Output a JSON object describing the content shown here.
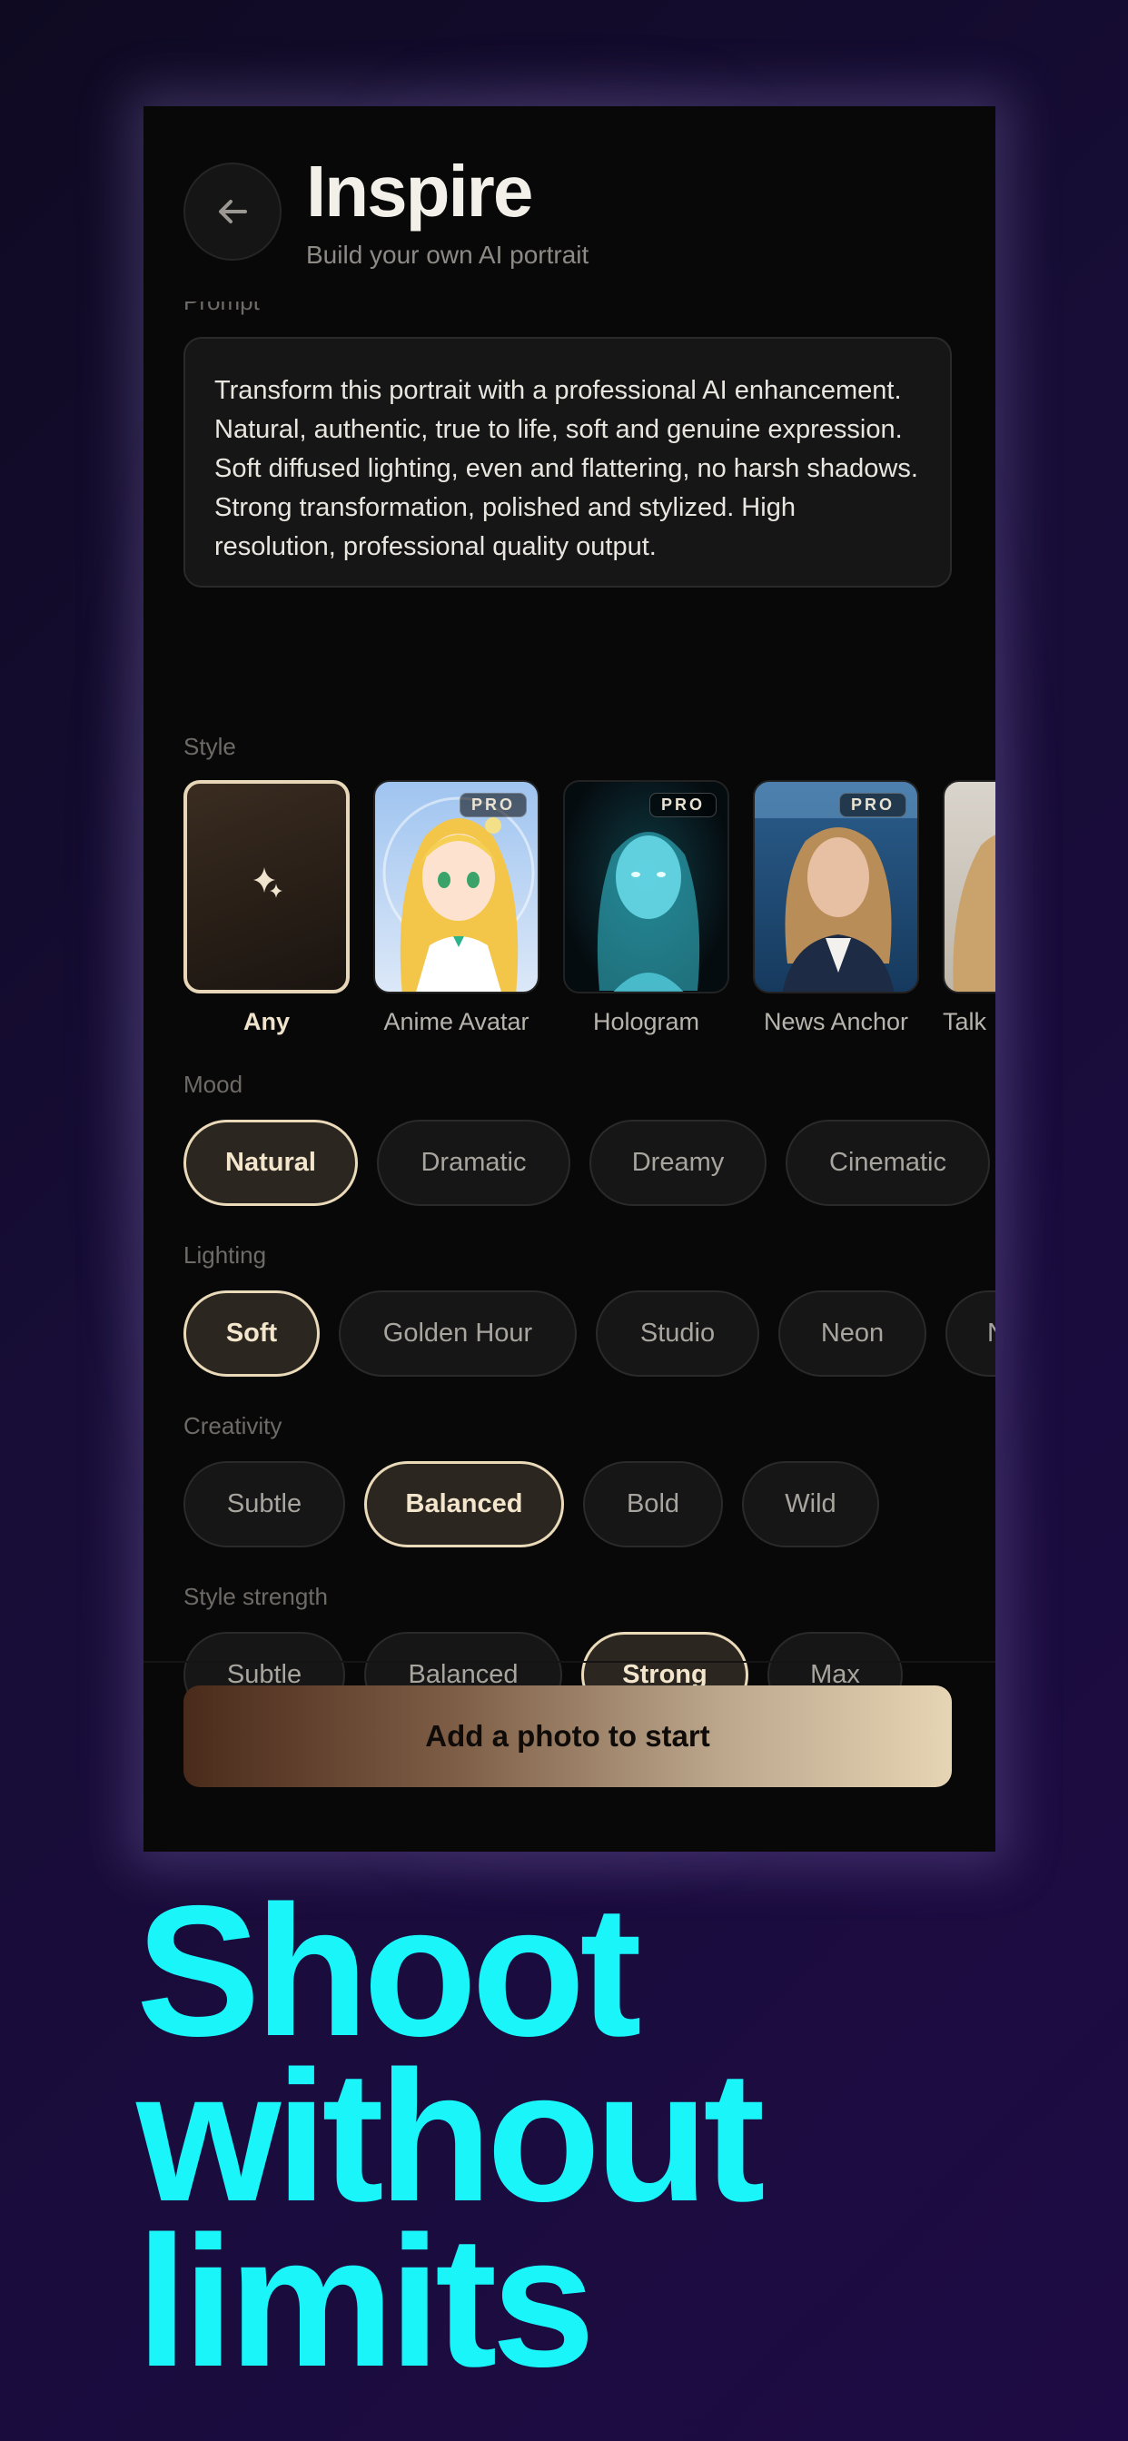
{
  "header": {
    "title": "Inspire",
    "subtitle": "Build your own AI portrait"
  },
  "prompt": {
    "label": "Prompt",
    "text": "Transform this portrait with a professional AI enhancement. Natural, authentic, true to life, soft and genuine expression. Soft diffused lighting, even and flattering, no harsh shadows. Strong transformation, polished and stylized. High resolution, professional quality output."
  },
  "style": {
    "label": "Style",
    "items": [
      {
        "name": "Any",
        "selected": true
      },
      {
        "name": "Anime Avatar",
        "badge": "PRO"
      },
      {
        "name": "Hologram",
        "badge": "PRO"
      },
      {
        "name": "News Anchor",
        "badge": "PRO"
      },
      {
        "name": "Talk"
      }
    ]
  },
  "mood": {
    "label": "Mood",
    "options": [
      "Natural",
      "Dramatic",
      "Dreamy",
      "Cinematic"
    ],
    "selected": "Natural"
  },
  "lighting": {
    "label": "Lighting",
    "options": [
      "Soft",
      "Golden Hour",
      "Studio",
      "Neon",
      "N"
    ],
    "selected": "Soft"
  },
  "creativity": {
    "label": "Creativity",
    "options": [
      "Subtle",
      "Balanced",
      "Bold",
      "Wild"
    ],
    "selected": "Balanced"
  },
  "style_strength": {
    "label": "Style strength",
    "options": [
      "Subtle",
      "Balanced",
      "Strong",
      "Max"
    ],
    "selected": "Strong"
  },
  "cta": {
    "label": "Add a photo to start"
  },
  "headline": {
    "line1": "Shoot",
    "line2": "without",
    "line3": "limits"
  },
  "colors": {
    "accent": "#19f5f9",
    "selection": "#eadab9",
    "background": "#080808"
  }
}
